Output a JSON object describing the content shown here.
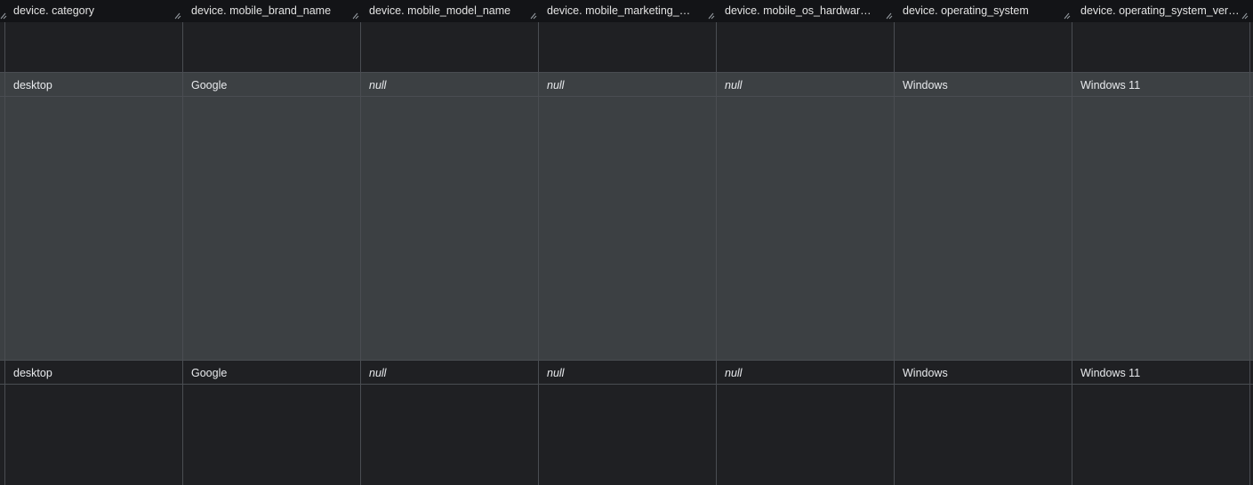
{
  "columns": [
    {
      "label": "device. category"
    },
    {
      "label": "device. mobile_brand_name"
    },
    {
      "label": "device. mobile_model_name"
    },
    {
      "label": "device. mobile_marketing_name"
    },
    {
      "label": "device. mobile_os_hardware_m..."
    },
    {
      "label": "device. operating_system"
    },
    {
      "label": "device. operating_system_version"
    }
  ],
  "rows": [
    {
      "cells": [
        "",
        "",
        "",
        "",
        "",
        "",
        ""
      ]
    },
    {
      "cells": [
        "desktop",
        "Google",
        "null",
        "null",
        "null",
        "Windows",
        "Windows 11"
      ]
    },
    {
      "cells": [
        "desktop",
        "Google",
        "null",
        "null",
        "null",
        "Windows",
        "Windows 11"
      ]
    }
  ],
  "colors": {
    "header_bg": "#131417",
    "row_dark": "#1f2023",
    "row_highlight": "#3c4043",
    "grid_line": "#4a4d52",
    "text": "#e8eaed"
  }
}
